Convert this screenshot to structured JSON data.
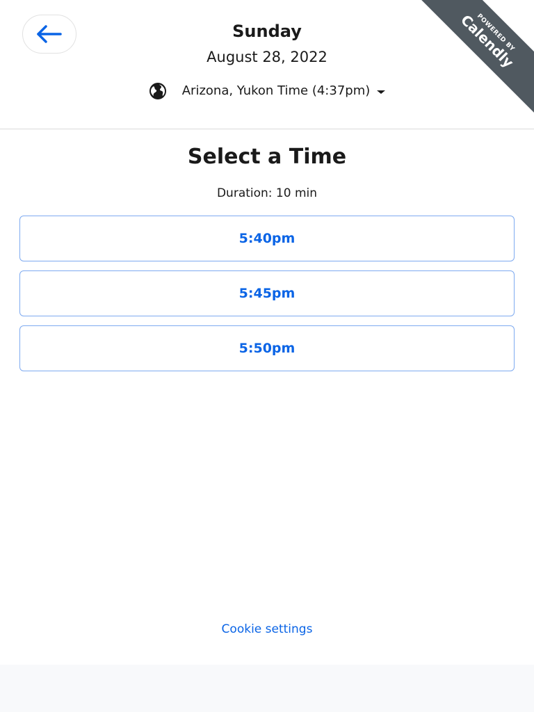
{
  "header": {
    "day": "Sunday",
    "date": "August 28, 2022",
    "timezone": "Arizona, Yukon Time (4:37pm)"
  },
  "ribbon": {
    "small": "POWERED BY",
    "brand": "Calendly"
  },
  "main": {
    "title": "Select a Time",
    "duration": "Duration: 10 min",
    "slots": [
      "5:40pm",
      "5:45pm",
      "5:50pm"
    ]
  },
  "footer": {
    "cookie_settings": "Cookie settings"
  },
  "colors": {
    "accent": "#0a64e6",
    "slot_border": "#7eaaf0",
    "ribbon": "#505960"
  },
  "icons": {
    "back": "arrow-left-icon",
    "timezone": "globe-icon",
    "dropdown": "caret-down-icon"
  }
}
